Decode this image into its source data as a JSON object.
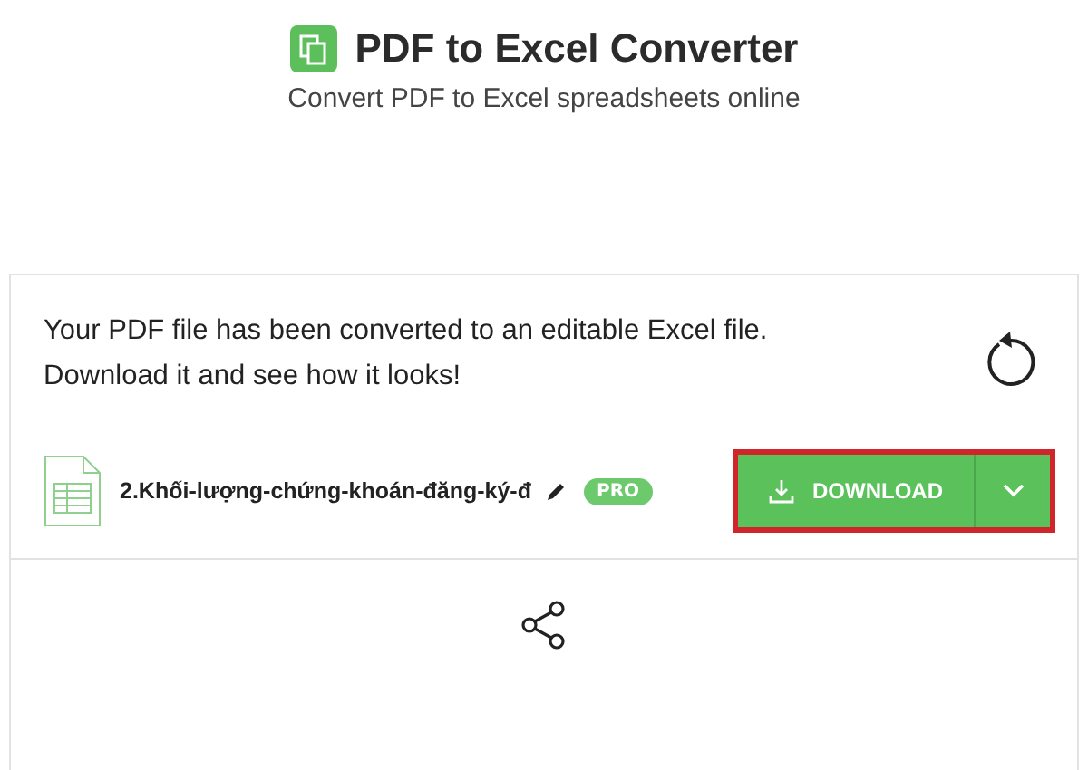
{
  "header": {
    "title": "PDF to Excel Converter",
    "subtitle": "Convert PDF to Excel spreadsheets online"
  },
  "result": {
    "message": "Your PDF file has been converted to an editable Excel file. Download it and see how it looks!"
  },
  "file": {
    "name": "2.Khối-lượng-chứng-khoán-đăng-ký-đ",
    "badge": "PRO"
  },
  "download": {
    "label": "DOWNLOAD",
    "highlighted": true
  }
}
